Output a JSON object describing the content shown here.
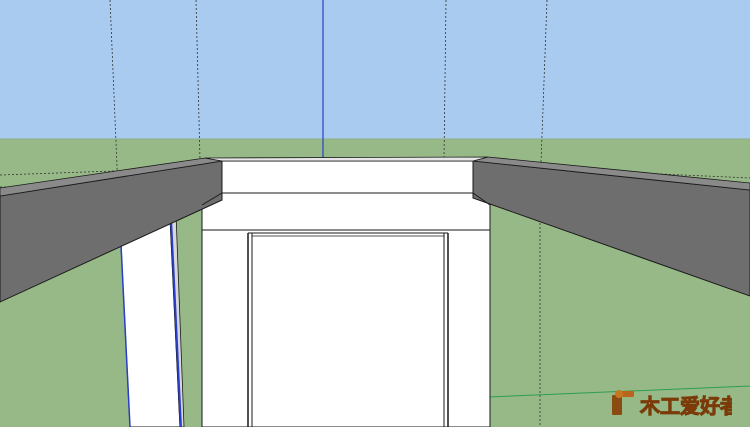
{
  "app": {
    "view": "3d-modeling-viewport"
  },
  "colors": {
    "sky": "#aacbf0",
    "ground": "#97b987",
    "wall_shade": "#6e6e6e",
    "face_white": "#ffffff",
    "edge": "#1a1a1a",
    "blue_axis": "#2a3fc9",
    "green_axis": "#2e9e4f"
  },
  "watermark": {
    "text": "木工爱好者"
  }
}
